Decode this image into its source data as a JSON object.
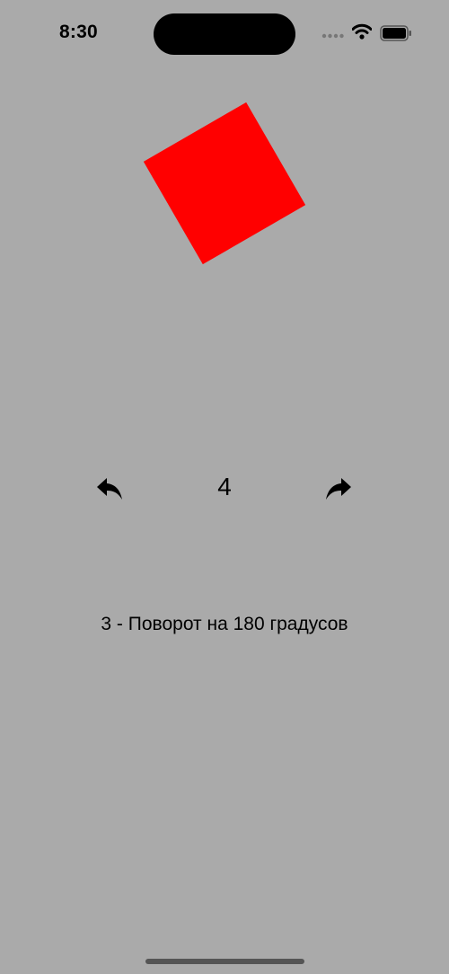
{
  "status_bar": {
    "time": "8:30",
    "icons": [
      "cellular-signal-icon",
      "wifi-icon",
      "battery-icon"
    ]
  },
  "canvas": {
    "shape": "square",
    "color": "#ff0000",
    "rotation_degrees": -30
  },
  "controls": {
    "back_icon": "undo-arrow-icon",
    "counter": "4",
    "forward_icon": "redo-arrow-icon"
  },
  "description": "3 - Поворот на 180 градусов",
  "colors": {
    "background": "#aaaaaa",
    "shape": "#ff0000"
  }
}
